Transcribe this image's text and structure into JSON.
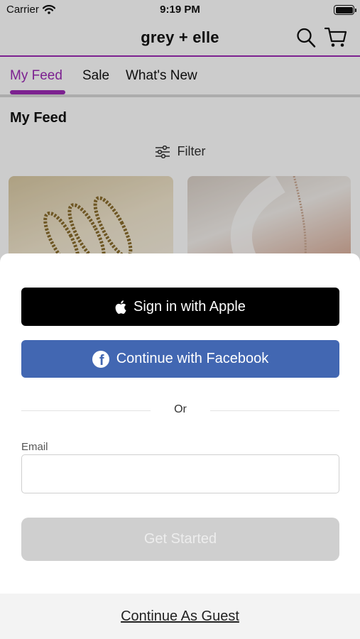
{
  "status_bar": {
    "carrier": "Carrier",
    "time": "9:19 PM"
  },
  "header": {
    "brand": "grey + elle"
  },
  "tabs": [
    {
      "label": "My Feed",
      "active": true
    },
    {
      "label": "Sale",
      "active": false
    },
    {
      "label": "What's New",
      "active": false
    }
  ],
  "feed": {
    "title": "My Feed",
    "filter_label": "Filter"
  },
  "modal": {
    "apple_button": "Sign in with Apple",
    "facebook_button": "Continue with Facebook",
    "or_text": "Or",
    "email_label": "Email",
    "email_value": "",
    "email_placeholder": "",
    "get_started_button": "Get Started",
    "guest_link": "Continue As Guest"
  },
  "colors": {
    "accent": "#9b2ab5",
    "apple_bg": "#000000",
    "facebook_bg": "#4267b2",
    "disabled_button": "#cfcfcf"
  }
}
